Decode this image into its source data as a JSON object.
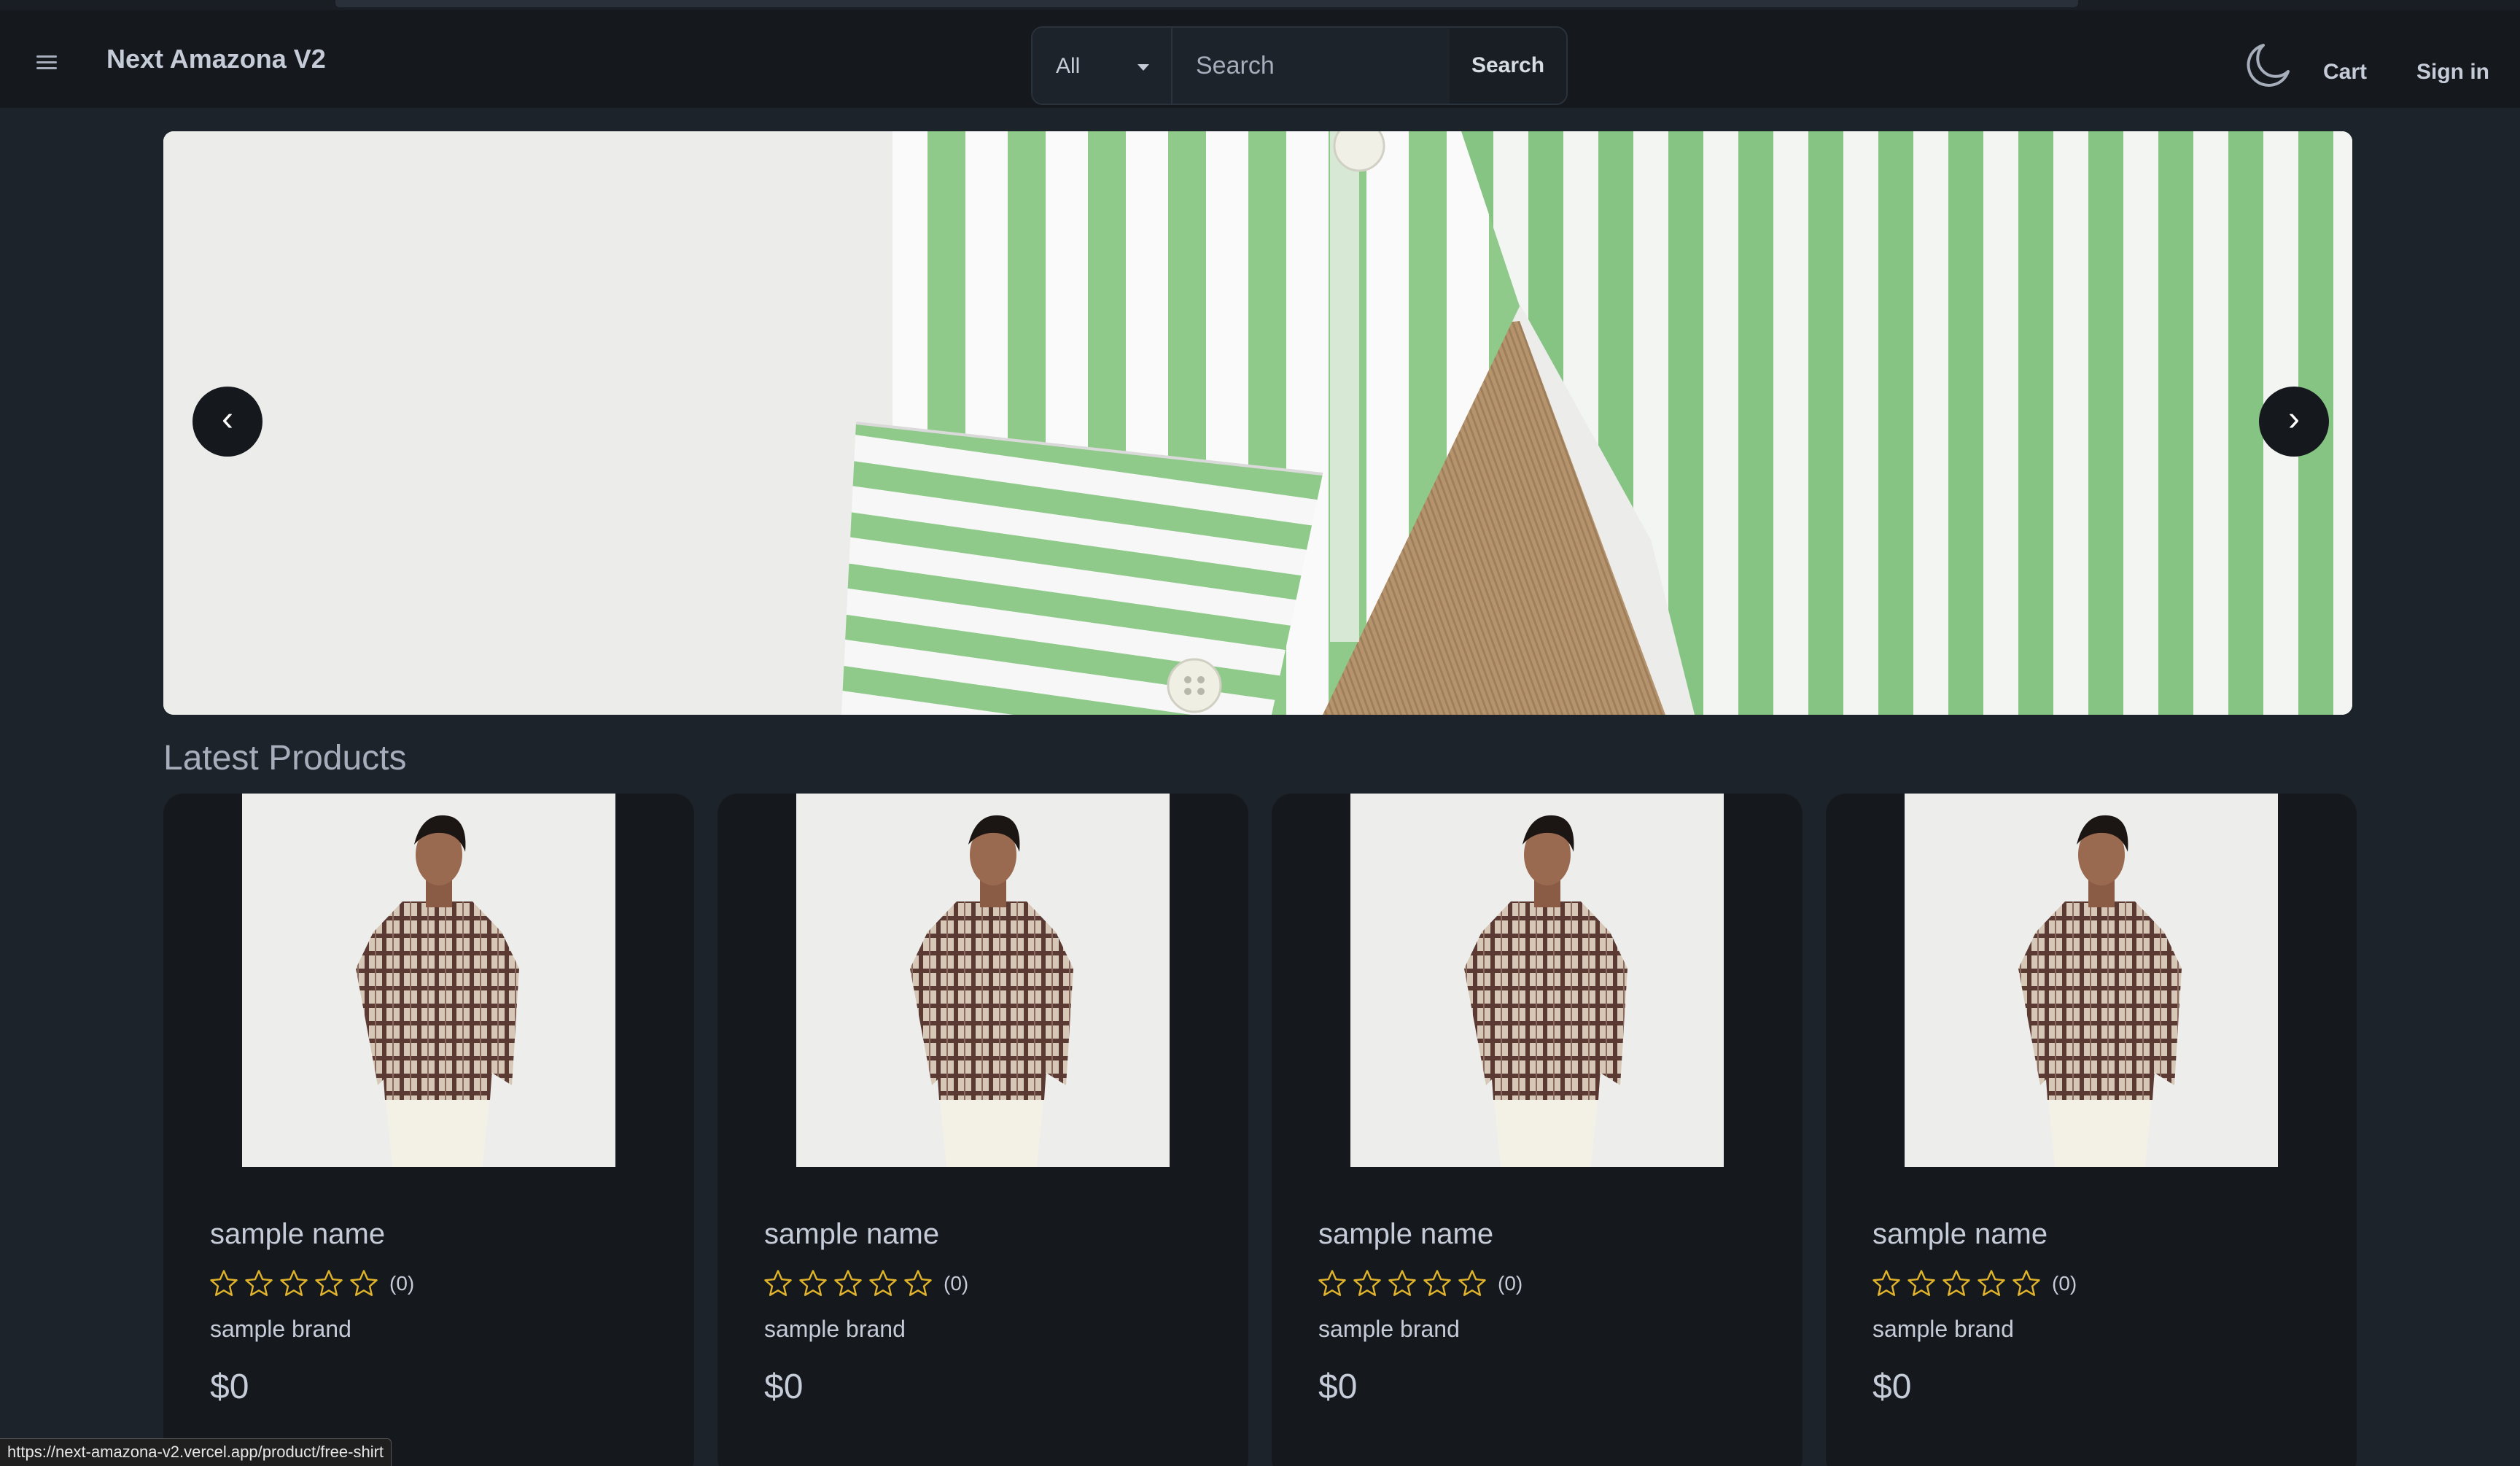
{
  "navbar": {
    "brand": "Next Amazona V2",
    "category_value": "All",
    "search_placeholder": "Search",
    "search_button": "Search",
    "cart": "Cart",
    "signin": "Sign in"
  },
  "carousel": {
    "prev": "‹",
    "next": "›"
  },
  "main": {
    "section_title": "Latest Products",
    "products": [
      {
        "name": "sample name",
        "rating_count": "(0)",
        "brand": "sample brand",
        "price": "$0"
      },
      {
        "name": "sample name",
        "rating_count": "(0)",
        "brand": "sample brand",
        "price": "$0"
      },
      {
        "name": "sample name",
        "rating_count": "(0)",
        "brand": "sample brand",
        "price": "$0"
      },
      {
        "name": "sample name",
        "rating_count": "(0)",
        "brand": "sample brand",
        "price": "$0"
      }
    ]
  },
  "status_bar": {
    "url": "https://next-amazona-v2.vercel.app/product/free-shirt"
  },
  "colors": {
    "background": "#1d232a",
    "navbar": "#15191e",
    "star": "#e0b32a",
    "shirt_green": "#8fca8a"
  }
}
